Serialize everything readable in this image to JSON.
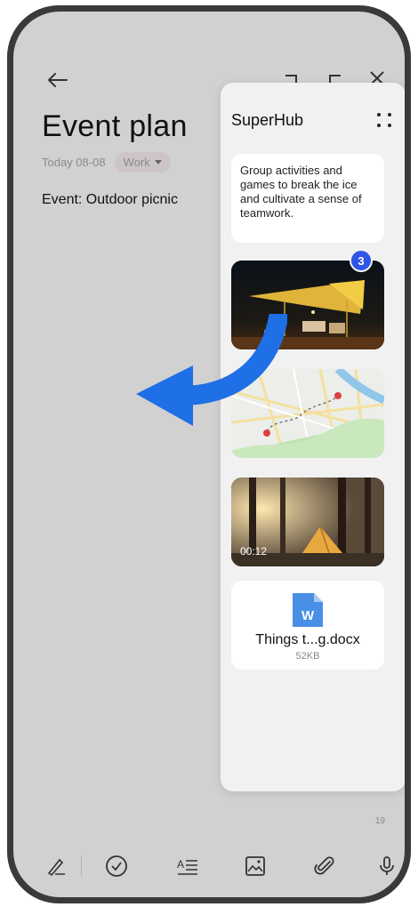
{
  "note": {
    "title": "Event plan",
    "date": "Today 08-08",
    "tag": "Work",
    "event_line": "Event: Outdoor picnic",
    "page_number": "19"
  },
  "superhub": {
    "title": "SuperHub",
    "note_text": "Group activities and games to break the ice and cultivate a sense of teamwork.",
    "image_badge": "3",
    "video_duration": "00:12",
    "doc_badge_letter": "W",
    "doc_name": "Things t...g.docx",
    "doc_size": "52KB"
  },
  "icons": {
    "top": [
      "back-arrow-icon",
      "undo-icon",
      "redo-icon",
      "close-icon"
    ],
    "bottom": [
      "handwriting-icon",
      "checklist-icon",
      "text-style-icon",
      "image-icon",
      "attachment-icon",
      "microphone-icon"
    ]
  },
  "colors": {
    "accent_blue": "#2f6fe0",
    "badge_blue": "#2f55e8",
    "doc_blue": "#4a8fe6",
    "screen_bg": "#d1d1d1",
    "panel_bg": "#f1f1f1"
  }
}
